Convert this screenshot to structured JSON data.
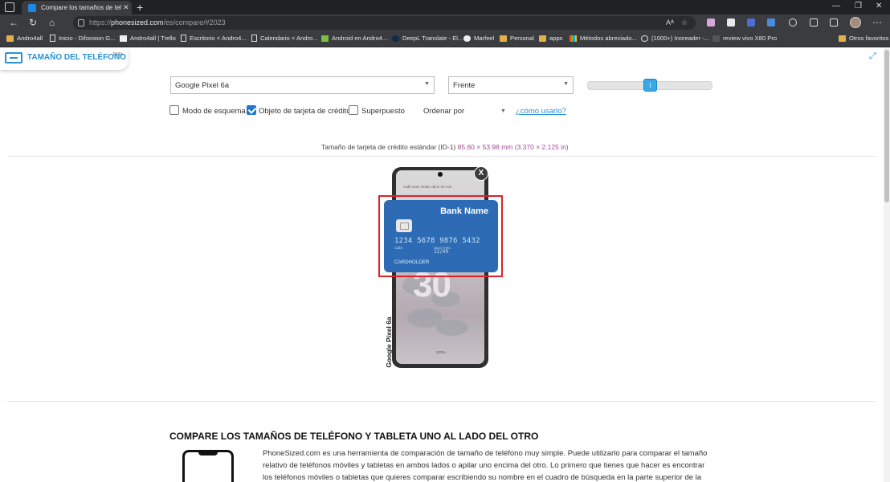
{
  "browser": {
    "tab_title": "Compare los tamaños de teléfo",
    "url_prefix": "https://",
    "url_domain": "phonesized.com",
    "url_path": "/es/compare/#2023",
    "bookmarks": [
      "Andro4all",
      "Inicio - Difoosion G...",
      "Andro4all | Trello",
      "Escritorio < Andro4...",
      "Calendario < Andro...",
      "Android en Andro4...",
      "DeepL Translate - El...",
      "Marfeel",
      "Personal",
      "apps",
      "Métodos abreviado...",
      "(1000+) Inoreader -...",
      "review vivo X80 Pro"
    ],
    "other_favorites": "Otros favoritos",
    "read_aloud_icon": "Aᴬ"
  },
  "site": {
    "logo_text": "TAMAÑO DEL TELÉFONO",
    "logo_beta": "beta"
  },
  "controls": {
    "device_select": "Google Pixel 6a",
    "view_select": "Frente",
    "slider_level": 0.45,
    "checkboxes": [
      {
        "label": "Modo de esquema",
        "checked": false
      },
      {
        "label": "Objeto de tarjeta de crédito",
        "checked": true
      },
      {
        "label": "Superpuesto",
        "checked": false
      }
    ],
    "order_label": "Ordenar por",
    "howto_link": "¿cómo usarlo?"
  },
  "card_info": {
    "text": "Tamaño de tarjeta de crédito estándar (ID-1)",
    "dims": "85.60 × 53.98 mm (3.370 × 2.125 in)"
  },
  "phone": {
    "name": "Google Pixel 6a",
    "notification": "Café avec Robin dans 30 min",
    "clock": "30",
    "battery": "100%"
  },
  "credit_card": {
    "bank": "Bank Name",
    "number": "1234 5678 9876 5432",
    "small_number": "1234",
    "valid_label": "VALID THRU",
    "expiry": "12/99",
    "holder": "CARDHOLDER"
  },
  "article": {
    "title": "COMPARE LOS TAMAÑOS DE TELÉFONO Y TABLETA UNO AL LADO DEL OTRO",
    "paragraph": "PhoneSized.com es una herramienta de comparación de tamaño de teléfono muy simple. Puede utilizarlo para comparar el tamaño relativo de teléfonos móviles y tabletas en ambos lados o apilar uno encima del otro. Lo primero que tienes que hacer es encontrar los teléfonos móviles o tabletas que quieres comparar escribiendo su nombre en el cuadro de búsqueda en la parte superior de la pantalla."
  }
}
